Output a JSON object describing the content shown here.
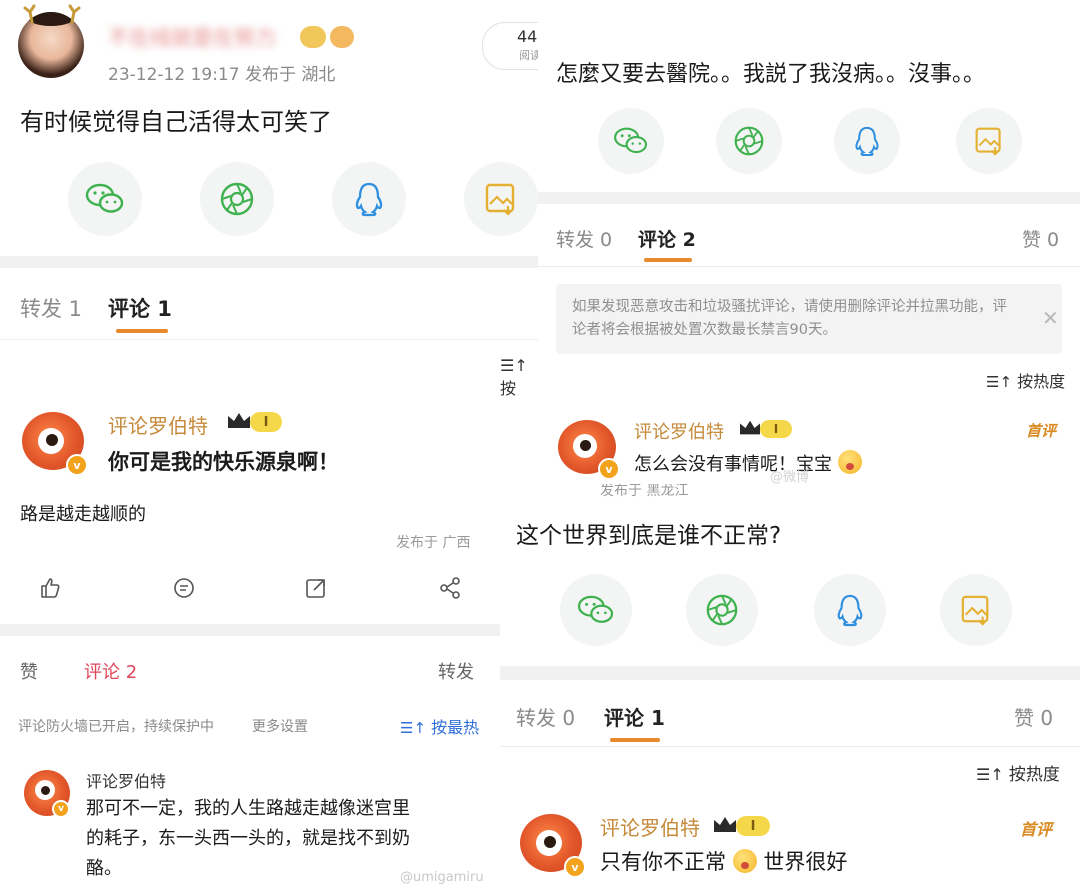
{
  "p1": {
    "user_name": "不在线就是在努力",
    "meta": "23-12-12 19:17  发布于 湖北",
    "views_count": "44",
    "views_label": "阅读",
    "post_text": "有时候觉得自己活得太可笑了",
    "tabs": {
      "repost": "转发 1",
      "comment": "评论 1"
    },
    "sort_label": "按",
    "commenter": "评论罗伯特",
    "level": "I",
    "comment_text": "你可是我的快乐源泉啊！"
  },
  "p2": {
    "post_text": "怎麼又要去醫院。。我説了我沒病。。沒事。。",
    "tabs": {
      "repost": "转发 0",
      "comment": "评论 2",
      "like": "赞 0"
    },
    "notice": "如果发现恶意攻击和垃圾骚扰评论，请使用删除评论并拉黑功能，评论者将会根据被处置次数最长禁言90天。",
    "sort_label": "按热度",
    "commenter": "评论罗伯特",
    "level": "I",
    "first_tag": "首评",
    "comment_text": "怎么会没有事情呢！宝宝",
    "watermark": "@微博"
  },
  "p3": {
    "post_text": "路是越走越顺的",
    "location": "发布于 广西",
    "tabs": {
      "like": "赞",
      "comment": "评论 2",
      "repost": "转发"
    },
    "firewall_text": "评论防火墙已开启，持续保护中",
    "more_settings": "更多设置",
    "sort_label": "按最热",
    "commenter": "评论罗伯特",
    "comment_text_1": "那可不一定，我的人生路越走越像迷宫里",
    "comment_text_2": "的耗子，东一头西一头的，就是找不到奶",
    "comment_text_3": "酪。",
    "watermark": "@umigamiru"
  },
  "p4": {
    "location_partial": "发布于 黑龙江",
    "post_text": "这个世界到底是谁不正常?",
    "tabs": {
      "repost": "转发 0",
      "comment": "评论 1",
      "like": "赞 0"
    },
    "sort_label": "按热度",
    "commenter": "评论罗伯特",
    "level": "I",
    "first_tag": "首评",
    "comment_text_a": "只有你不正常",
    "comment_text_b": "世界很好"
  },
  "colors": {
    "accent": "#e8892b",
    "wechat": "#3fb14f",
    "moments": "#3fb14f",
    "qq": "#2f8fe0",
    "save": "#e4b032",
    "red_tab": "#e0475a"
  },
  "icons": [
    "wechat-icon",
    "moments-icon",
    "qq-icon",
    "save-image-icon",
    "like-icon",
    "comment-icon",
    "share-icon",
    "more-share-icon",
    "sort-icon",
    "close-icon",
    "crown-icon"
  ]
}
